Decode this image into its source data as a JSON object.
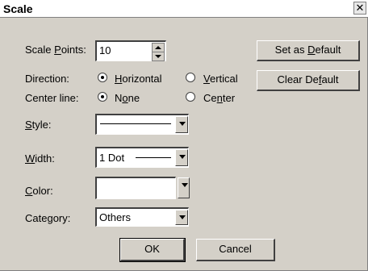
{
  "window": {
    "title": "Scale",
    "close_glyph": "✕"
  },
  "scale_points": {
    "label_pre": "Scale ",
    "label_ul": "P",
    "label_post": "oints:",
    "value": "10"
  },
  "buttons": {
    "set_default": {
      "pre": "Set as ",
      "ul": "D",
      "post": "efault"
    },
    "clear_default": {
      "pre": "Clear De",
      "ul": "f",
      "post": "ault"
    },
    "ok": "OK",
    "cancel": "Cancel"
  },
  "direction": {
    "label": "Direction:",
    "options": [
      {
        "pre": "",
        "ul": "H",
        "post": "orizontal",
        "selected": true
      },
      {
        "pre": "",
        "ul": "V",
        "post": "ertical",
        "selected": false
      }
    ]
  },
  "center_line": {
    "label": "Center line:",
    "options": [
      {
        "pre": "N",
        "ul": "o",
        "post": "ne",
        "selected": true
      },
      {
        "pre": "Ce",
        "ul": "n",
        "post": "ter",
        "selected": false
      }
    ]
  },
  "style": {
    "pre": "",
    "ul": "S",
    "post": "tyle:",
    "value": "solid line"
  },
  "width": {
    "pre": "",
    "ul": "W",
    "post": "idth:",
    "value": "1 Dot"
  },
  "color": {
    "pre": "",
    "ul": "C",
    "post": "olor:",
    "value": "white"
  },
  "category": {
    "pre": "Cate",
    "ul": "g",
    "post": "ory:",
    "value": "Others"
  }
}
